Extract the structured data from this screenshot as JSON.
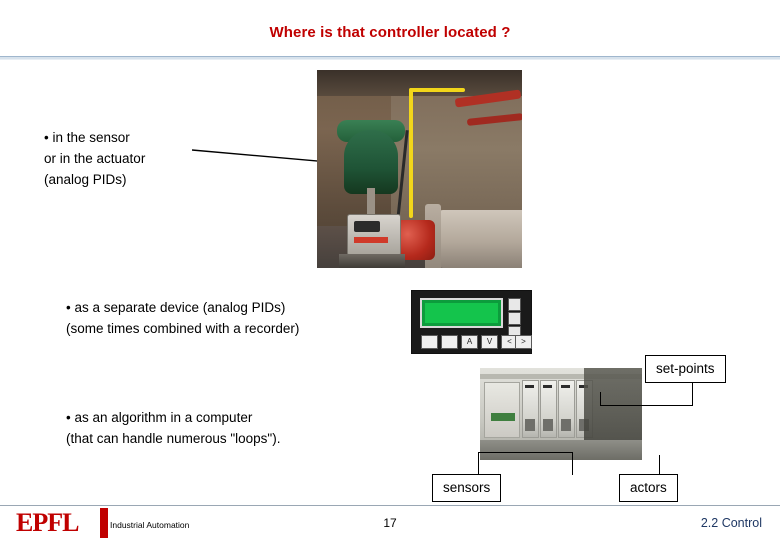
{
  "slide": {
    "title": "Where is that controller located ?",
    "bullets": [
      {
        "text": "•  in the sensor\nor in the actuator\n(analog PIDs)"
      },
      {
        "text": "•  as a separate device (analog PIDs)\n(some times combined with a recorder)"
      },
      {
        "text": "•  as an algorithm in a computer\n(that can handle numerous \"loops\")."
      }
    ],
    "callouts": {
      "set_points": "set-points",
      "sensors": "sensors",
      "actors": "actors"
    },
    "panel_keys": [
      "",
      "",
      "A",
      "V",
      "<",
      ">"
    ],
    "footer": {
      "logo": "EPFL",
      "course": "Industrial Automation",
      "page": "17",
      "section": "2.2 Control"
    },
    "colors": {
      "title": "#c00000",
      "section": "#1f3864",
      "lcd": "#14c44c"
    }
  }
}
